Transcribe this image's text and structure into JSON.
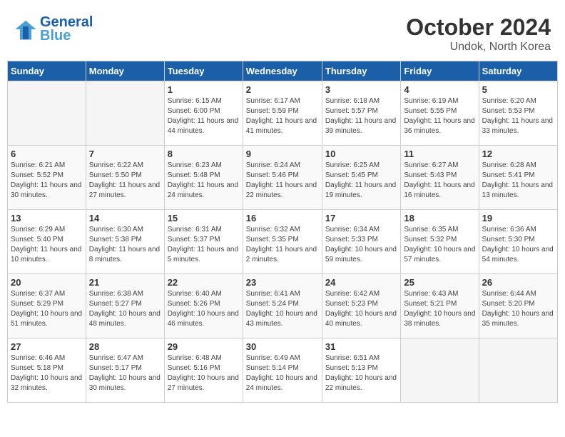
{
  "header": {
    "logo_line1": "General",
    "logo_line2": "Blue",
    "title": "October 2024",
    "subtitle": "Undok, North Korea"
  },
  "columns": [
    "Sunday",
    "Monday",
    "Tuesday",
    "Wednesday",
    "Thursday",
    "Friday",
    "Saturday"
  ],
  "weeks": [
    {
      "days": [
        {
          "num": "",
          "info": ""
        },
        {
          "num": "",
          "info": ""
        },
        {
          "num": "1",
          "info": "Sunrise: 6:15 AM\nSunset: 6:00 PM\nDaylight: 11 hours and 44 minutes."
        },
        {
          "num": "2",
          "info": "Sunrise: 6:17 AM\nSunset: 5:59 PM\nDaylight: 11 hours and 41 minutes."
        },
        {
          "num": "3",
          "info": "Sunrise: 6:18 AM\nSunset: 5:57 PM\nDaylight: 11 hours and 39 minutes."
        },
        {
          "num": "4",
          "info": "Sunrise: 6:19 AM\nSunset: 5:55 PM\nDaylight: 11 hours and 36 minutes."
        },
        {
          "num": "5",
          "info": "Sunrise: 6:20 AM\nSunset: 5:53 PM\nDaylight: 11 hours and 33 minutes."
        }
      ]
    },
    {
      "days": [
        {
          "num": "6",
          "info": "Sunrise: 6:21 AM\nSunset: 5:52 PM\nDaylight: 11 hours and 30 minutes."
        },
        {
          "num": "7",
          "info": "Sunrise: 6:22 AM\nSunset: 5:50 PM\nDaylight: 11 hours and 27 minutes."
        },
        {
          "num": "8",
          "info": "Sunrise: 6:23 AM\nSunset: 5:48 PM\nDaylight: 11 hours and 24 minutes."
        },
        {
          "num": "9",
          "info": "Sunrise: 6:24 AM\nSunset: 5:46 PM\nDaylight: 11 hours and 22 minutes."
        },
        {
          "num": "10",
          "info": "Sunrise: 6:25 AM\nSunset: 5:45 PM\nDaylight: 11 hours and 19 minutes."
        },
        {
          "num": "11",
          "info": "Sunrise: 6:27 AM\nSunset: 5:43 PM\nDaylight: 11 hours and 16 minutes."
        },
        {
          "num": "12",
          "info": "Sunrise: 6:28 AM\nSunset: 5:41 PM\nDaylight: 11 hours and 13 minutes."
        }
      ]
    },
    {
      "days": [
        {
          "num": "13",
          "info": "Sunrise: 6:29 AM\nSunset: 5:40 PM\nDaylight: 11 hours and 10 minutes."
        },
        {
          "num": "14",
          "info": "Sunrise: 6:30 AM\nSunset: 5:38 PM\nDaylight: 11 hours and 8 minutes."
        },
        {
          "num": "15",
          "info": "Sunrise: 6:31 AM\nSunset: 5:37 PM\nDaylight: 11 hours and 5 minutes."
        },
        {
          "num": "16",
          "info": "Sunrise: 6:32 AM\nSunset: 5:35 PM\nDaylight: 11 hours and 2 minutes."
        },
        {
          "num": "17",
          "info": "Sunrise: 6:34 AM\nSunset: 5:33 PM\nDaylight: 10 hours and 59 minutes."
        },
        {
          "num": "18",
          "info": "Sunrise: 6:35 AM\nSunset: 5:32 PM\nDaylight: 10 hours and 57 minutes."
        },
        {
          "num": "19",
          "info": "Sunrise: 6:36 AM\nSunset: 5:30 PM\nDaylight: 10 hours and 54 minutes."
        }
      ]
    },
    {
      "days": [
        {
          "num": "20",
          "info": "Sunrise: 6:37 AM\nSunset: 5:29 PM\nDaylight: 10 hours and 51 minutes."
        },
        {
          "num": "21",
          "info": "Sunrise: 6:38 AM\nSunset: 5:27 PM\nDaylight: 10 hours and 48 minutes."
        },
        {
          "num": "22",
          "info": "Sunrise: 6:40 AM\nSunset: 5:26 PM\nDaylight: 10 hours and 46 minutes."
        },
        {
          "num": "23",
          "info": "Sunrise: 6:41 AM\nSunset: 5:24 PM\nDaylight: 10 hours and 43 minutes."
        },
        {
          "num": "24",
          "info": "Sunrise: 6:42 AM\nSunset: 5:23 PM\nDaylight: 10 hours and 40 minutes."
        },
        {
          "num": "25",
          "info": "Sunrise: 6:43 AM\nSunset: 5:21 PM\nDaylight: 10 hours and 38 minutes."
        },
        {
          "num": "26",
          "info": "Sunrise: 6:44 AM\nSunset: 5:20 PM\nDaylight: 10 hours and 35 minutes."
        }
      ]
    },
    {
      "days": [
        {
          "num": "27",
          "info": "Sunrise: 6:46 AM\nSunset: 5:18 PM\nDaylight: 10 hours and 32 minutes."
        },
        {
          "num": "28",
          "info": "Sunrise: 6:47 AM\nSunset: 5:17 PM\nDaylight: 10 hours and 30 minutes."
        },
        {
          "num": "29",
          "info": "Sunrise: 6:48 AM\nSunset: 5:16 PM\nDaylight: 10 hours and 27 minutes."
        },
        {
          "num": "30",
          "info": "Sunrise: 6:49 AM\nSunset: 5:14 PM\nDaylight: 10 hours and 24 minutes."
        },
        {
          "num": "31",
          "info": "Sunrise: 6:51 AM\nSunset: 5:13 PM\nDaylight: 10 hours and 22 minutes."
        },
        {
          "num": "",
          "info": ""
        },
        {
          "num": "",
          "info": ""
        }
      ]
    }
  ]
}
